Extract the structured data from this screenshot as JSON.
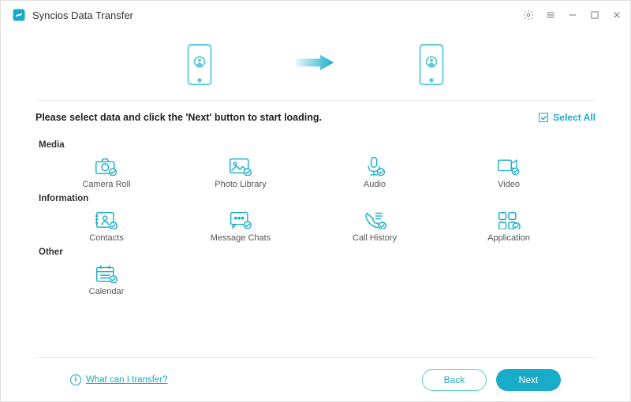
{
  "title": "Syncios Data Transfer",
  "instruction": "Please select data and click the 'Next' button to start loading.",
  "select_all_label": "Select All",
  "sections": {
    "media": {
      "label": "Media",
      "items": [
        "Camera Roll",
        "Photo Library",
        "Audio",
        "Video"
      ]
    },
    "information": {
      "label": "Information",
      "items": [
        "Contacts",
        "Message Chats",
        "Call History",
        "Application"
      ]
    },
    "other": {
      "label": "Other",
      "items": [
        "Calendar"
      ]
    }
  },
  "footer": {
    "help_text": "What can I transfer?",
    "back_label": "Back",
    "next_label": "Next"
  },
  "colors": {
    "accent": "#18acc9"
  }
}
